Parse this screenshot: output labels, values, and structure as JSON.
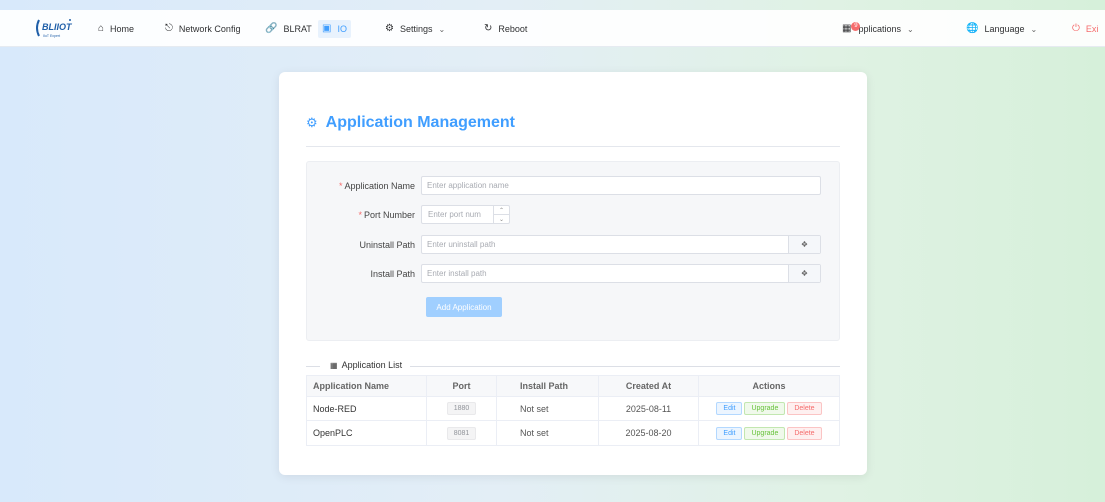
{
  "nav": {
    "logo_text": "BLIIOT",
    "logo_sub": "IIoT Expert",
    "home": "Home",
    "network_config": "Network Config",
    "blrat": "BLRAT",
    "io": "IO",
    "settings": "Settings",
    "reboot": "Reboot",
    "applications": "Applications",
    "applications_label": "pplications",
    "applications_badge": "9",
    "language": "Language",
    "exit": "Exit",
    "exit_visible": "Exi"
  },
  "page": {
    "title": "Application Management"
  },
  "form": {
    "app_name_label": "Application Name",
    "app_name_placeholder": "Enter application name",
    "port_label": "Port Number",
    "port_placeholder": "Enter port num",
    "uninstall_label": "Uninstall Path",
    "uninstall_placeholder": "Enter uninstall path",
    "install_label": "Install Path",
    "install_placeholder": "Enter install path",
    "add_button": "Add Application"
  },
  "list": {
    "title": "Application List",
    "columns": [
      "Application Name",
      "Port",
      "Install Path",
      "Created At",
      "Actions"
    ],
    "rows": [
      {
        "name": "Node-RED",
        "port": "1880",
        "install_path": "Not set",
        "created": "2025-08-11"
      },
      {
        "name": "OpenPLC",
        "port": "8081",
        "install_path": "Not set",
        "created": "2025-08-20"
      }
    ],
    "actions": {
      "edit": "Edit",
      "upgrade": "Upgrade",
      "delete": "Delete"
    }
  },
  "colors": {
    "accent": "#409eff",
    "danger": "#f56c6c",
    "success": "#67c23a"
  }
}
